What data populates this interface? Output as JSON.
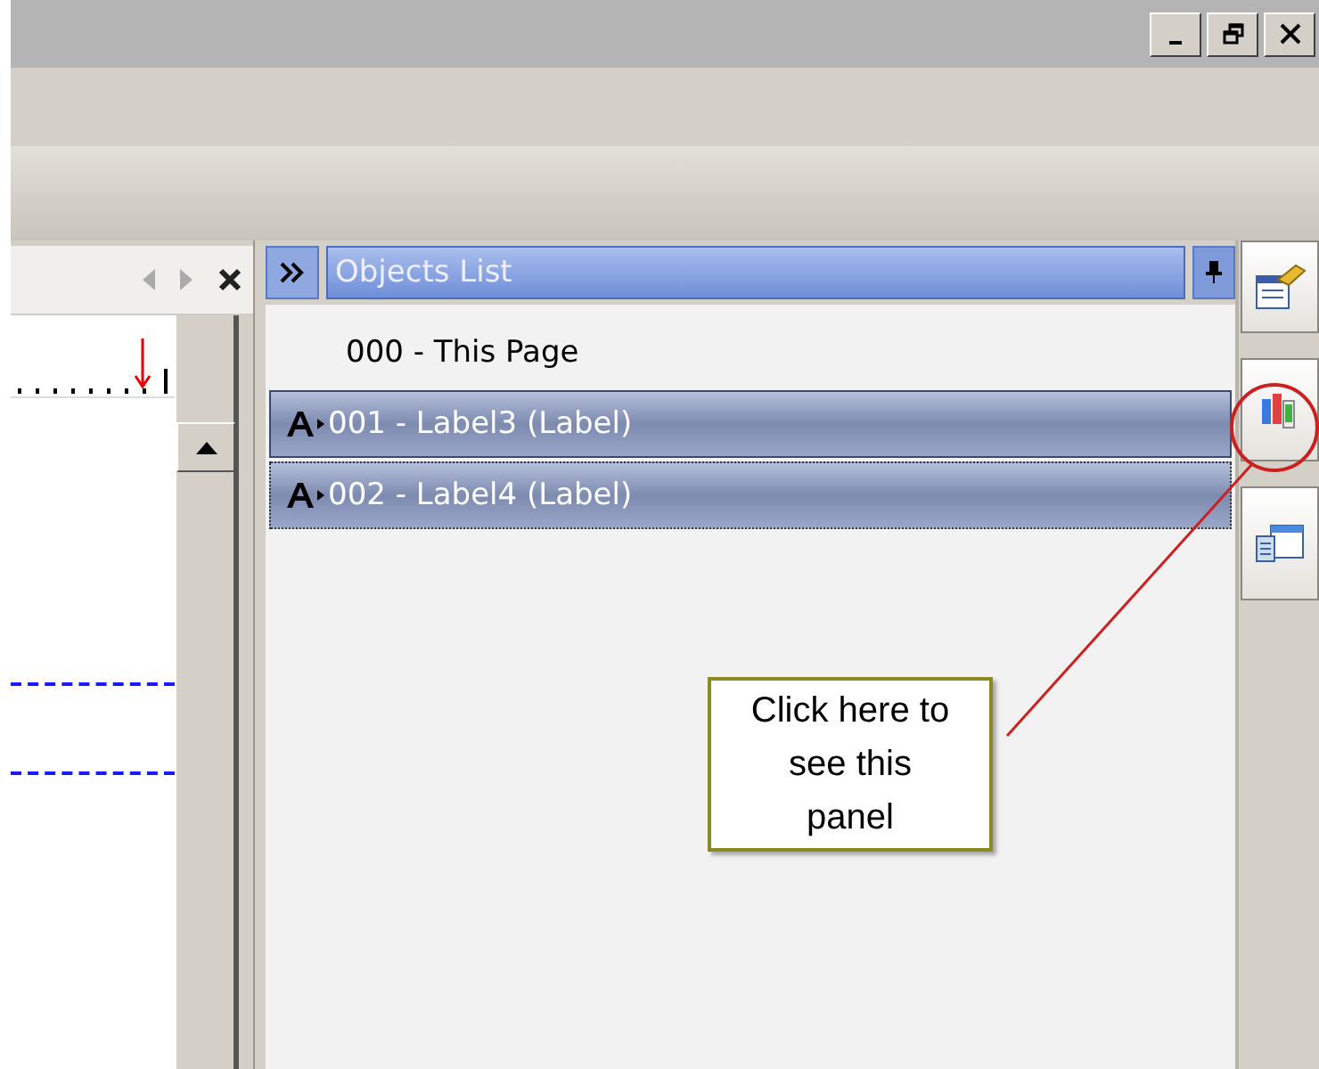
{
  "window": {
    "controls": [
      {
        "kind": "minimize"
      },
      {
        "kind": "restore"
      },
      {
        "kind": "close"
      }
    ]
  },
  "document_tab": {
    "nav_back_disabled": true,
    "nav_forward_disabled": true
  },
  "objects_list": {
    "title": "Objects List",
    "items": [
      {
        "kind": "page",
        "label": "000 - This Page",
        "selected": false,
        "focused": false
      },
      {
        "kind": "label",
        "label": "001 - Label3 (Label)",
        "selected": true,
        "focused": false
      },
      {
        "kind": "label",
        "label": "002 - Label4 (Label)",
        "selected": true,
        "focused": true
      }
    ]
  },
  "side_buttons": [
    {
      "kind": "properties",
      "highlighted": false
    },
    {
      "kind": "objects",
      "highlighted": true
    },
    {
      "kind": "pages",
      "highlighted": false
    }
  ],
  "callout": {
    "text": "Click here to\nsee this\npanel"
  }
}
